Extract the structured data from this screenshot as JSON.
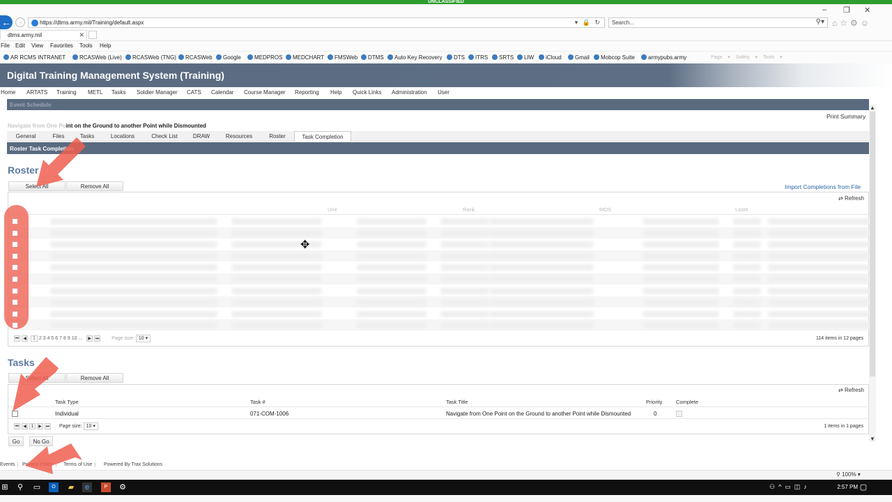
{
  "banner": "UNCLASSIFIED",
  "browser": {
    "url": "https://dtms.army.mil/Training/default.aspx",
    "search_placeholder": "Search...",
    "tab_title": "dtms.army.mil",
    "menu": [
      "File",
      "Edit",
      "View",
      "Favorites",
      "Tools",
      "Help"
    ],
    "favorites": [
      "AR RCMS INTRANET",
      "RCASWeb (Live)",
      "RCASWeb (TNG)",
      "RCASWeb",
      "Google",
      "MEDPROS",
      "MEDCHART",
      "FMSWeb",
      "DTMS",
      "Auto Key Recovery",
      "DTS",
      "ITRS",
      "SRTS",
      "LIW",
      "iCloud",
      "Gmail",
      "Mobcop Suite",
      "armypubs.army"
    ],
    "toolbar_right": "Page ▾  Safety ▾  Tools ▾",
    "zoom": "100%"
  },
  "app": {
    "title": "Digital Training Management System (Training)",
    "nav": [
      "Home",
      "ARTATS",
      "Training",
      "METL",
      "Tasks",
      "Soldier Manager",
      "CATS",
      "Calendar",
      "Course Manager",
      "Reporting",
      "Help",
      "Quick Links",
      "Administration",
      "User"
    ]
  },
  "event": {
    "header": "Event Schedule",
    "print_summary": "Print Summary",
    "title_faint": "Navigate from One Po",
    "title_rest": "int on the Ground to another Point while Dismounted",
    "tabs": [
      "General",
      "Files",
      "Tasks",
      "Locations",
      "Check List",
      "DRAW",
      "Resources",
      "Roster",
      "Task Completion"
    ],
    "active_tab": "Task Completion"
  },
  "roster_task_completion": {
    "header": "Roster Task Completion",
    "roster": {
      "heading": "Roster",
      "select_all": "Select All",
      "remove_all": "Remove All",
      "import": "Import Completions from File",
      "refresh": "Refresh",
      "columns": [
        "Unit",
        "Rank",
        "MOS",
        "Last4"
      ],
      "row_count": 10,
      "pager": {
        "pages": [
          "1",
          "2",
          "3",
          "4",
          "5",
          "6",
          "7",
          "8",
          "9",
          "10",
          "..."
        ],
        "page_size_label": "Page size:",
        "page_size": "10",
        "summary": "114 items in 12 pages"
      }
    },
    "tasks": {
      "heading": "Tasks",
      "select_all": "Select All",
      "remove_all": "Remove All",
      "refresh": "Refresh",
      "columns": [
        "Task Type",
        "Task #",
        "Task Title",
        "Priority",
        "Complete"
      ],
      "rows": [
        {
          "type": "Individual",
          "number": "071-COM-1006",
          "title": "Navigate from One Point on the Ground to another Point while Dismounted",
          "priority": "0"
        }
      ],
      "pager": {
        "page": "1",
        "page_size_label": "Page size:",
        "page_size": "10",
        "summary": "1 items in 1 pages"
      }
    },
    "go": "Go",
    "no_go": "No Go"
  },
  "footer": [
    "Events",
    "Privacy Policy",
    "Terms of Use",
    "Powered By Trax Solutions"
  ],
  "taskbar": {
    "time": "2:57 PM"
  },
  "annotation_color": "#f05f50"
}
